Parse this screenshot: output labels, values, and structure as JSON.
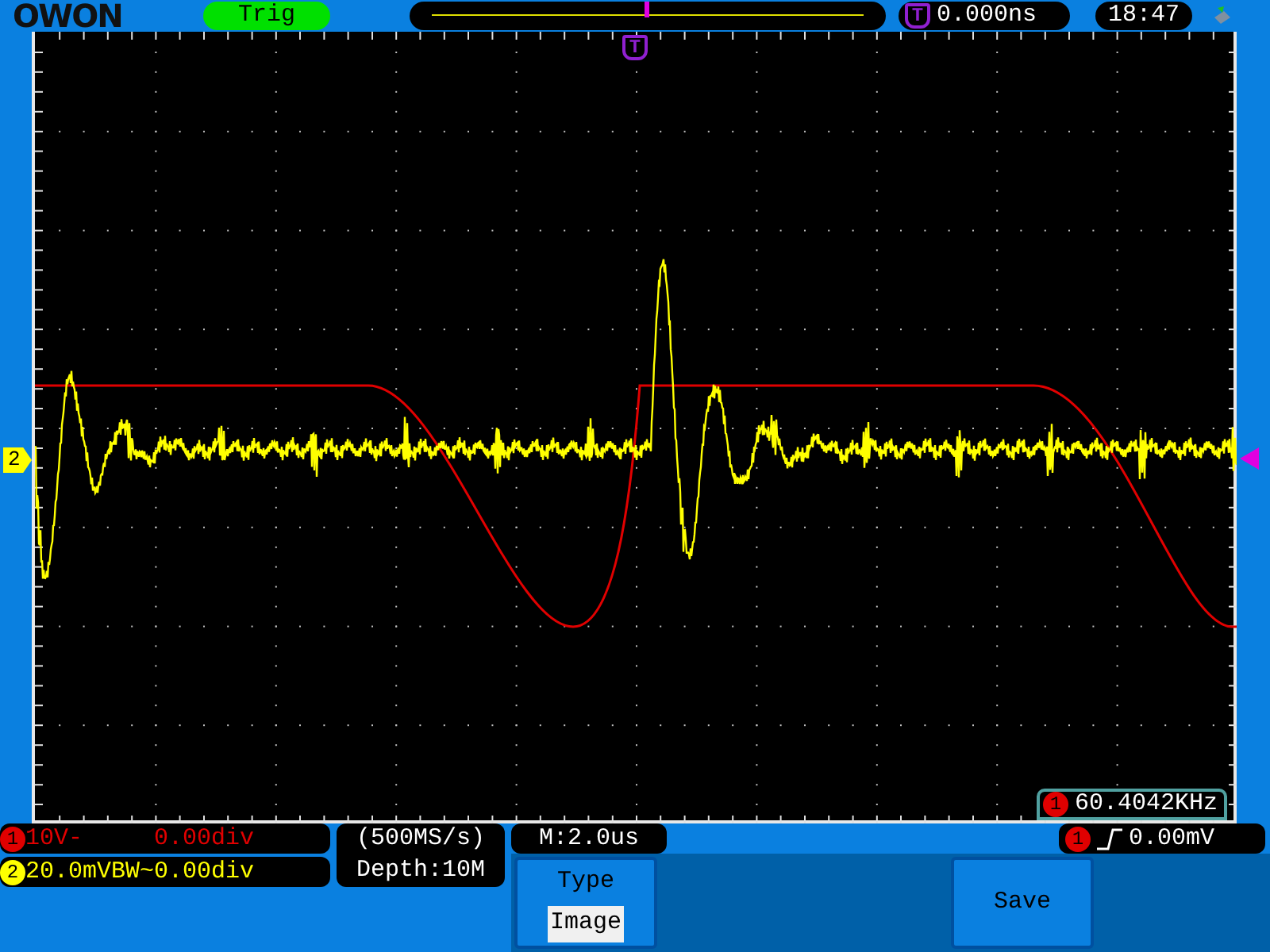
{
  "logo": "OWON",
  "trigger_status": "Trig",
  "trigger_time": {
    "marker": "T",
    "value": "0.000ns"
  },
  "clock": "18:47",
  "screen_markers": {
    "trigger_position": "T",
    "channel_2": "2"
  },
  "frequency": {
    "channel": "1",
    "value": "60.4042KHz"
  },
  "channels": [
    {
      "number": "1",
      "scale": "10V-",
      "offset": "0.00div",
      "color": "#e00000"
    },
    {
      "number": "2",
      "scale": "20.0mVBW~",
      "offset": "0.00div",
      "color": "#ffff00"
    }
  ],
  "acquisition": {
    "sample_rate": "(500MS/s)",
    "depth": "Depth:10M"
  },
  "timebase": "M:2.0us",
  "trigger": {
    "channel": "1",
    "level": "0.00mV"
  },
  "menu": [
    {
      "kind": "option",
      "title": "Type",
      "value": "Image"
    },
    {
      "kind": "action",
      "label": "Save"
    }
  ]
}
